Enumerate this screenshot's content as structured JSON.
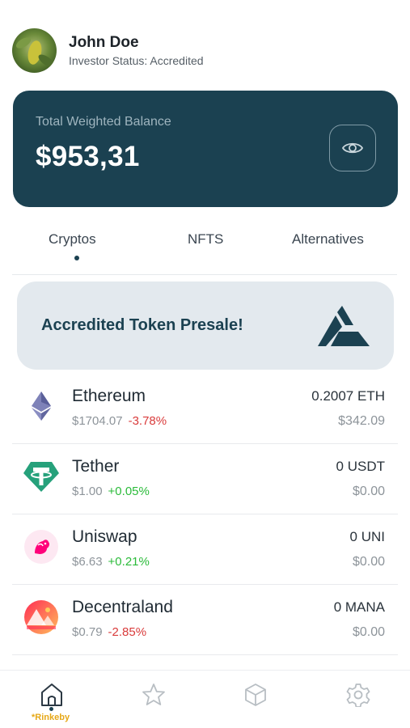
{
  "user": {
    "name": "John Doe",
    "status": "Investor Status: Accredited",
    "avatar_icon": "avatar-photo"
  },
  "balance": {
    "label": "Total Weighted Balance",
    "value": "$953,31",
    "toggle_icon": "eye-icon"
  },
  "tabs": [
    {
      "label": "Cryptos",
      "active": true
    },
    {
      "label": "NFTS",
      "active": false
    },
    {
      "label": "Alternatives",
      "active": false
    }
  ],
  "promo": {
    "text": "Accredited Token Presale!",
    "logo_icon": "accredited-logo-icon"
  },
  "assets": [
    {
      "name": "Ethereum",
      "price": "$1704.07",
      "change": "-3.78%",
      "amount": "0.2007 ETH",
      "usd": "$342.09",
      "icon": "ethereum-icon"
    },
    {
      "name": "Tether",
      "price": "$1.00",
      "change": "+0.05%",
      "amount": "0 USDT",
      "usd": "$0.00",
      "icon": "tether-icon"
    },
    {
      "name": "Uniswap",
      "price": "$6.63",
      "change": "+0.21%",
      "amount": "0 UNI",
      "usd": "$0.00",
      "icon": "uniswap-icon"
    },
    {
      "name": "Decentraland",
      "price": "$0.79",
      "change": "-2.85%",
      "amount": "0 MANA",
      "usd": "$0.00",
      "icon": "decentraland-icon"
    }
  ],
  "nav": {
    "items": [
      "home-icon",
      "star-icon",
      "cube-icon",
      "gear-icon"
    ],
    "network": "*Rinkeby"
  },
  "colors": {
    "primary": "#1b4151",
    "negative": "#d93b3b",
    "positive": "#2bbb3a",
    "network": "#e6a817"
  }
}
